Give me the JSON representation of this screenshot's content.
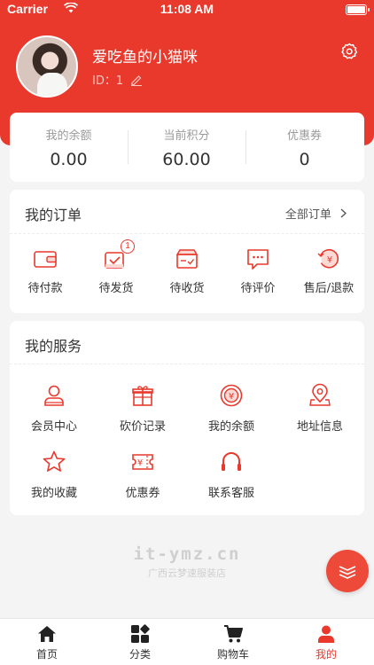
{
  "status_bar": {
    "carrier": "Carrier",
    "time": "11:08 AM"
  },
  "profile": {
    "username": "爱吃鱼的小猫咪",
    "id_text": "ID：1"
  },
  "balance": [
    {
      "label": "我的余额",
      "value": "0.00"
    },
    {
      "label": "当前积分",
      "value": "60.00"
    },
    {
      "label": "优惠券",
      "value": "0"
    }
  ],
  "orders": {
    "title": "我的订单",
    "all_label": "全部订单",
    "items": [
      {
        "label": "待付款",
        "icon": "wallet-icon"
      },
      {
        "label": "待发货",
        "icon": "pending-ship-icon",
        "badge": "1"
      },
      {
        "label": "待收货",
        "icon": "box-icon"
      },
      {
        "label": "待评价",
        "icon": "comment-icon"
      },
      {
        "label": "售后/退款",
        "icon": "refund-icon"
      }
    ]
  },
  "services": {
    "title": "我的服务",
    "items": [
      {
        "label": "会员中心",
        "icon": "user-icon"
      },
      {
        "label": "砍价记录",
        "icon": "gift-icon"
      },
      {
        "label": "我的余额",
        "icon": "yen-coin-icon"
      },
      {
        "label": "地址信息",
        "icon": "location-icon"
      },
      {
        "label": "我的收藏",
        "icon": "star-icon"
      },
      {
        "label": "优惠券",
        "icon": "coupon-icon"
      },
      {
        "label": "联系客服",
        "icon": "headset-icon"
      }
    ]
  },
  "watermark": {
    "line1": "it-ymz.cn",
    "line2": "广西云梦速服装店"
  },
  "tabbar": [
    {
      "label": "首页",
      "icon": "home-icon"
    },
    {
      "label": "分类",
      "icon": "category-icon"
    },
    {
      "label": "购物车",
      "icon": "cart-icon"
    },
    {
      "label": "我的",
      "icon": "person-icon",
      "active": true
    }
  ],
  "colors": {
    "accent": "#e8392c",
    "background": "#f4f4f4",
    "card": "#ffffff"
  }
}
